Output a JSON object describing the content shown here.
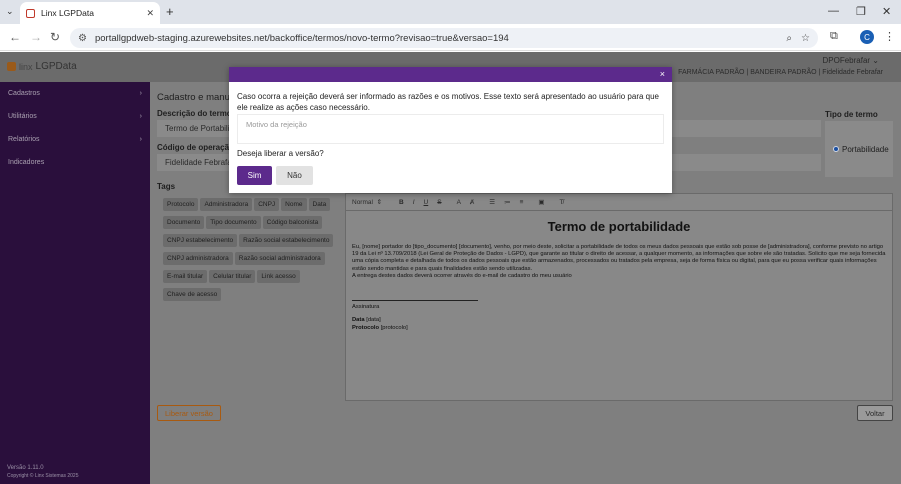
{
  "browser": {
    "tab_title": "Linx LGPData",
    "url": "portallgpdweb-staging.azurewebsites.net/backoffice/termos/novo-termo?revisao=true&versao=194",
    "profile_initial": "C"
  },
  "header": {
    "logo_prefix": "linx",
    "logo_name": "LGPData",
    "user": "DPOFebrafar",
    "company": "FARMÁCIA PADRÃO | BANDEIRA PADRÃO | Fidelidade Febrafar"
  },
  "sidebar": {
    "items": [
      {
        "label": "Cadastros",
        "chevron": "›"
      },
      {
        "label": "Utilitários",
        "chevron": "›"
      },
      {
        "label": "Relatórios",
        "chevron": "›"
      },
      {
        "label": "Indicadores",
        "chevron": ""
      }
    ],
    "version": "Versão 1.11.0",
    "copyright": "Copyright © Linx Sistemas 2025"
  },
  "main": {
    "page_title": "Cadastro e manu",
    "descricao_label": "Descrição do termo",
    "descricao_value": "Termo de Portabili",
    "codigo_label": "Código de operação",
    "codigo_value": "Fidelidade Febrafa",
    "tags_label": "Tags",
    "tags": [
      "Protocolo",
      "Administradora",
      "CNPJ",
      "Nome",
      "Data",
      "Documento",
      "Tipo documento",
      "Código balconista",
      "CNPJ estabelecimento",
      "Razão social estabelecimento",
      "CNPJ administradora",
      "Razão social administradora",
      "E-mail titular",
      "Celular titular",
      "Link acesso",
      "Chave de acesso"
    ],
    "tipo_label": "Tipo de termo",
    "tipo_option": "Portabilidade",
    "liberar_button": "Liberar versão",
    "voltar_button": "Voltar"
  },
  "editor": {
    "format_select": "Normal",
    "doc_title": "Termo de portabilidade",
    "paragraph_1": "Eu, [nome] portador do [tipo_documento] [documento], venho, por meio deste, solicitar a portabilidade de todos os meus dados pessoais que estão sob posse de [administradora], conforme previsto no artigo 19 da Lei nº 13.709/2018 (Lei Geral de Proteção de Dados - LGPD), que garante ao titular o direito de acessar, a qualquer momento, as informações que sobre ele são tratadas. Solicito que me seja fornecida uma cópia completa e detalhada de todos os dados pessoais que estão armazenados, processados ou tratados pela empresa, seja de forma física ou digital, para que eu possa verificar quais informações estão sendo mantidas e para quais finalidades estão sendo utilizadas.",
    "paragraph_2": "A entrega destes dados deverá ocorrer através do e-mail de cadastro do meu usuário",
    "signature_label": "Assinatura",
    "data_label": "Data",
    "data_value": "[data]",
    "protocolo_label": "Protocolo",
    "protocolo_value": "[protocolo]"
  },
  "modal": {
    "message": "Caso ocorra a rejeição deverá ser informado as razões e os motivos. Esse texto será apresentado ao usuário para que ele realize as ações caso necessário.",
    "placeholder": "Motivo da rejeição",
    "question": "Deseja liberar a versão?",
    "yes": "Sim",
    "no": "Não",
    "close": "×"
  }
}
